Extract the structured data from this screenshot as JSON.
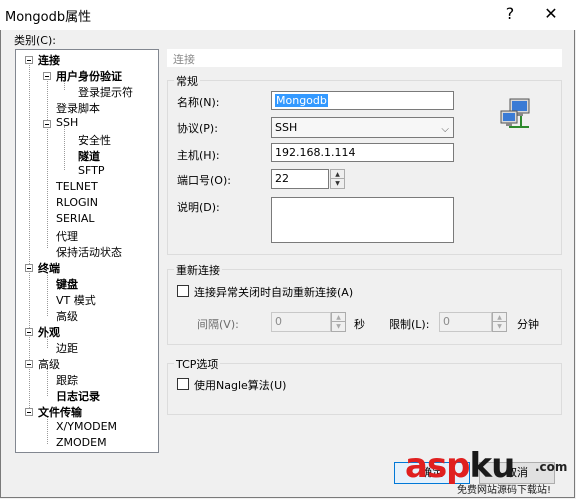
{
  "window": {
    "title": "Mongodb属性",
    "help_label": "?",
    "close_label": "✕"
  },
  "category_label": "类别(C):",
  "tree": {
    "nodes": [
      {
        "label": "连接",
        "bold": true
      },
      {
        "label": "用户身份验证",
        "bold": true
      },
      {
        "label": "登录提示符",
        "bold": false
      },
      {
        "label": "登录脚本",
        "bold": false
      },
      {
        "label": "SSH",
        "bold": false
      },
      {
        "label": "安全性",
        "bold": false
      },
      {
        "label": "隧道",
        "bold": true
      },
      {
        "label": "SFTP",
        "bold": false
      },
      {
        "label": "TELNET",
        "bold": false
      },
      {
        "label": "RLOGIN",
        "bold": false
      },
      {
        "label": "SERIAL",
        "bold": false
      },
      {
        "label": "代理",
        "bold": false
      },
      {
        "label": "保持活动状态",
        "bold": false
      },
      {
        "label": "终端",
        "bold": true
      },
      {
        "label": "键盘",
        "bold": true
      },
      {
        "label": "VT 模式",
        "bold": false
      },
      {
        "label": "高级",
        "bold": false
      },
      {
        "label": "外观",
        "bold": true
      },
      {
        "label": "边距",
        "bold": false
      },
      {
        "label": "高级",
        "bold": false
      },
      {
        "label": "跟踪",
        "bold": false
      },
      {
        "label": "日志记录",
        "bold": true
      },
      {
        "label": "文件传输",
        "bold": true
      },
      {
        "label": "X/YMODEM",
        "bold": false
      },
      {
        "label": "ZMODEM",
        "bold": false
      }
    ]
  },
  "panel": {
    "header": "连接",
    "general": {
      "title": "常规",
      "name_label": "名称(N):",
      "name_value": "Mongodb",
      "protocol_label": "协议(P):",
      "protocol_value": "SSH",
      "host_label": "主机(H):",
      "host_value": "192.168.1.114",
      "port_label": "端口号(O):",
      "port_value": "22",
      "desc_label": "说明(D):",
      "desc_value": ""
    },
    "reconnect": {
      "title": "重新连接",
      "checkbox_label": "连接异常关闭时自动重新连接(A)",
      "interval_label": "间隔(V):",
      "interval_value": "0",
      "interval_unit": "秒",
      "limit_label": "限制(L):",
      "limit_value": "0",
      "limit_unit": "分钟"
    },
    "tcp": {
      "title": "TCP选项",
      "nagle_label": "使用Nagle算法(U)"
    }
  },
  "buttons": {
    "ok": "确定",
    "cancel": "取消"
  },
  "icons": {
    "network": "network-computers-icon",
    "expander": "tree-collapse-icon",
    "dropdown": "chevron-down-icon"
  },
  "watermark": {
    "brand_a": "asp",
    "brand_b": "ku",
    "tld": ".com",
    "sub": "免费网站源码下载站!"
  }
}
